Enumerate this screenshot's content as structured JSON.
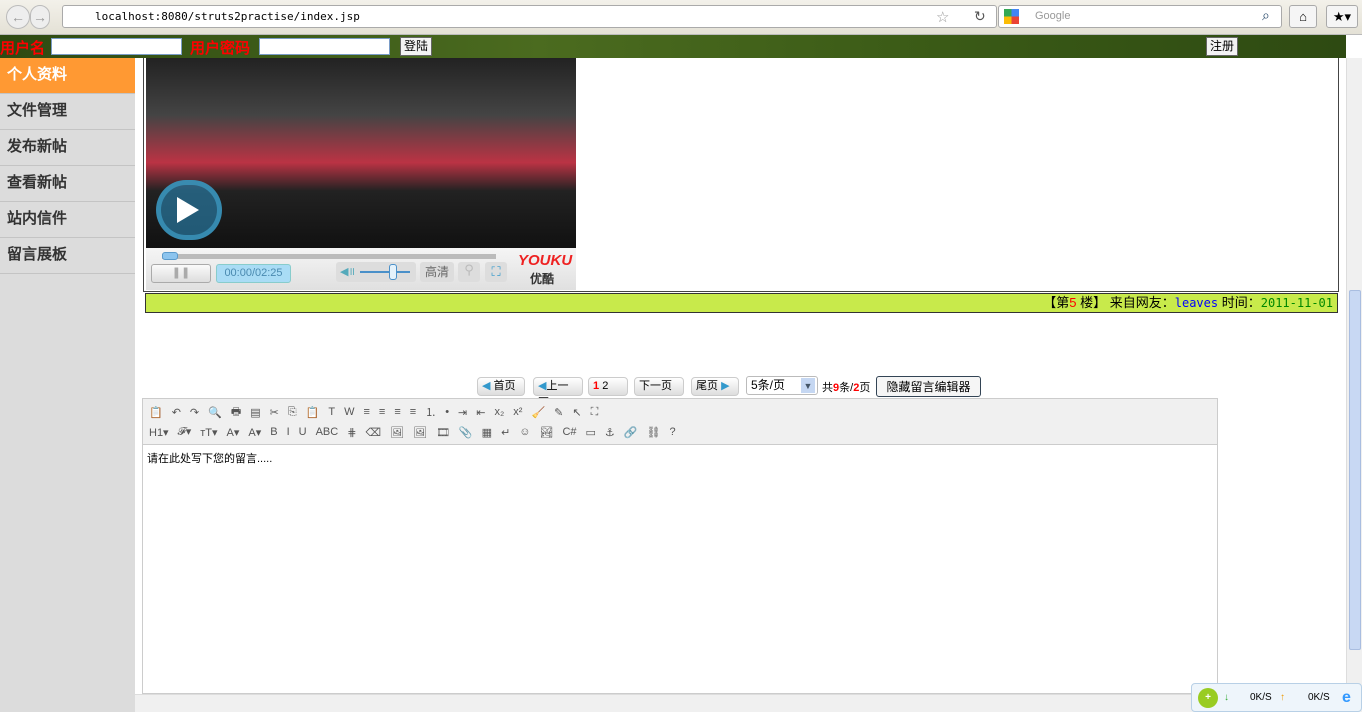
{
  "browser": {
    "url": "localhost:8080/struts2practise/index.jsp",
    "search_placeholder": "Google"
  },
  "login": {
    "username_label": "用户名",
    "password_label": "用户密码",
    "login_button": "登陆",
    "register_button": "注册"
  },
  "sidebar": {
    "items": [
      {
        "label": "个人资料"
      },
      {
        "label": "文件管理"
      },
      {
        "label": "发布新帖"
      },
      {
        "label": "查看新帖"
      },
      {
        "label": "站内信件"
      },
      {
        "label": "留言展板"
      }
    ]
  },
  "video": {
    "time": "00:00/02:25",
    "hd": "高清",
    "brand": "YOUKU",
    "brand_cn": "优酷",
    "volume": 0.75,
    "progress": 0
  },
  "post": {
    "floor_prefix": "【第",
    "floor_num": "5",
    "floor_suffix": " 楼】",
    "from_label": "来自网友：",
    "user": "leaves",
    "time_label": "时间：",
    "date": "2011-11-01"
  },
  "pager": {
    "first": "首页",
    "prev": "上一页",
    "page1": "1",
    "page2": "2",
    "next": "下一页",
    "last": "尾页",
    "per_page": "5条/页",
    "total_prefix": "共",
    "total_count": "9",
    "total_mid": "条/",
    "total_pages": "2",
    "total_suffix": "页",
    "hide_editor": "隐藏留言编辑器"
  },
  "editor": {
    "content": "请在此处写下您的留言.....",
    "row1": [
      "📋",
      "↶",
      "↷",
      "🔍",
      "🖶",
      "▤",
      "✂",
      "⎘",
      "📋",
      "T",
      "W",
      "≡",
      "≡",
      "≡",
      "≡",
      "⒈",
      "•",
      "⇥",
      "⇤",
      "x₂",
      "x²",
      "🧹",
      "✎",
      "↖",
      "⛶"
    ],
    "row2": [
      "H1▾",
      "𝓕▾",
      "ᴛT▾",
      "A▾",
      "A▾",
      "B",
      "I",
      "U",
      "ABC",
      "⋕",
      "⌫",
      "🖼",
      "🖼",
      "🎞",
      "📎",
      "▦",
      "↵",
      "☺",
      "🏞",
      "C#",
      "▭",
      "⚓",
      "🔗",
      "⛓",
      "?"
    ]
  },
  "status": {
    "down": "0K/S",
    "up": "0K/S"
  },
  "colors": {
    "accent": "#ff9933",
    "floor_bar": "#c8ea4b"
  }
}
